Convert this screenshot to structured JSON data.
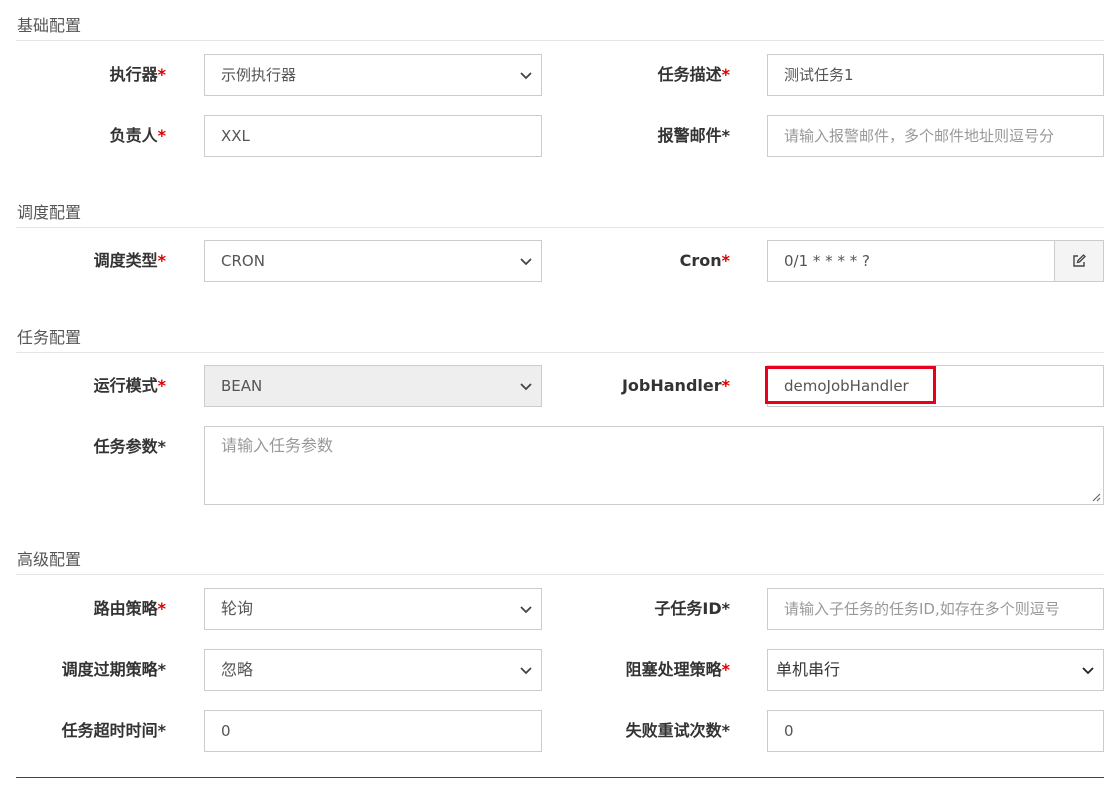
{
  "sections": {
    "basic": "基础配置",
    "schedule": "调度配置",
    "task": "任务配置",
    "advanced": "高级配置"
  },
  "required_mark": "*",
  "fields": {
    "executor": {
      "label": "执行器",
      "value": "示例执行器"
    },
    "job_desc": {
      "label": "任务描述",
      "value": "测试任务1"
    },
    "owner": {
      "label": "负责人",
      "value": "XXL"
    },
    "alarm_email": {
      "label": "报警邮件",
      "placeholder": "请输入报警邮件，多个邮件地址则逗号分"
    },
    "schedule_type": {
      "label": "调度类型",
      "value": "CRON"
    },
    "cron": {
      "label": "Cron",
      "value": "0/1 * * * * ?"
    },
    "run_mode": {
      "label": "运行模式",
      "value": "BEAN"
    },
    "job_handler": {
      "label": "JobHandler",
      "value": "demoJobHandler"
    },
    "job_param": {
      "label": "任务参数",
      "placeholder": "请输入任务参数"
    },
    "route_strategy": {
      "label": "路由策略",
      "value": "轮询"
    },
    "child_job_id": {
      "label": "子任务ID",
      "placeholder": "请输入子任务的任务ID,如存在多个则逗号"
    },
    "misfire_strategy": {
      "label": "调度过期策略",
      "value": "忽略"
    },
    "block_strategy": {
      "label": "阻塞处理策略",
      "value": "单机串行"
    },
    "timeout": {
      "label": "任务超时时间",
      "value": "0"
    },
    "fail_retry": {
      "label": "失败重试次数",
      "value": "0"
    }
  },
  "icons": {
    "chevron": "chevron-down-icon",
    "edit": "edit-icon",
    "resize": "resize-grip-icon"
  },
  "colors": {
    "required": "#dd0000",
    "highlight": "#e8001c",
    "border": "#cccccc",
    "disabled_bg": "#eeeeee"
  }
}
